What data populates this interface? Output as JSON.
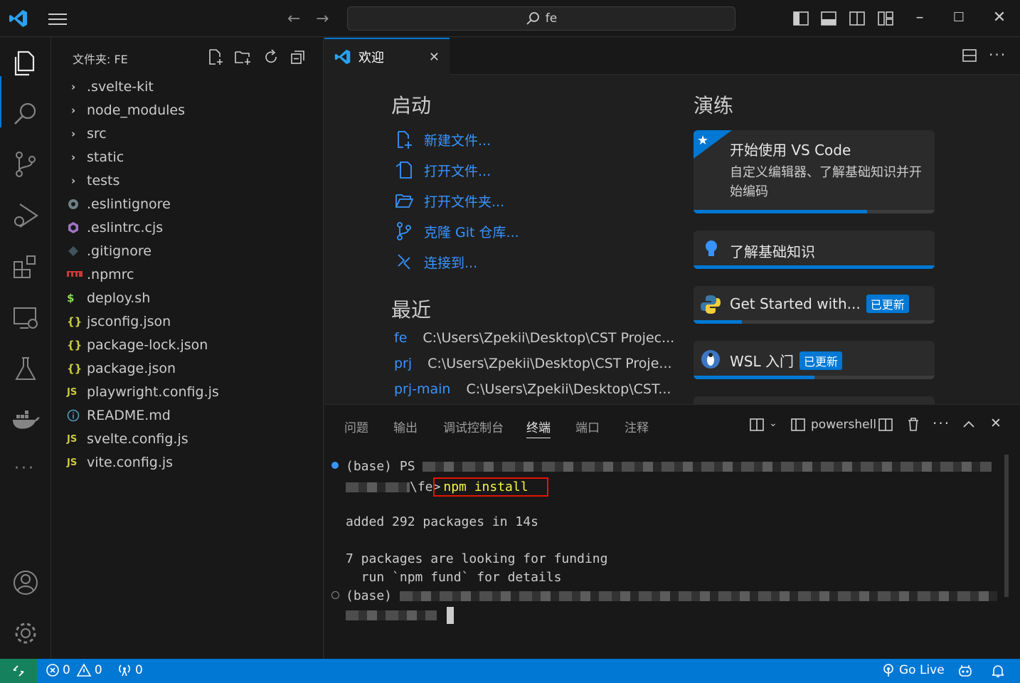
{
  "titlebar": {
    "search_text": "fe"
  },
  "sidebar": {
    "header": "文件夹: FE",
    "items": [
      {
        "label": ".svelte-kit",
        "type": "folder"
      },
      {
        "label": "node_modules",
        "type": "folder"
      },
      {
        "label": "src",
        "type": "folder"
      },
      {
        "label": "static",
        "type": "folder"
      },
      {
        "label": "tests",
        "type": "folder"
      },
      {
        "label": ".eslintignore",
        "icon": "gear-file-icon",
        "color": "#6d8086"
      },
      {
        "label": ".eslintrc.cjs",
        "icon": "eslint-icon",
        "color": "#a074c4"
      },
      {
        "label": ".gitignore",
        "icon": "git-icon",
        "color": "#41535b"
      },
      {
        "label": ".npmrc",
        "icon": "npm-icon",
        "color": "#cb3837"
      },
      {
        "label": "deploy.sh",
        "icon": "dollar-icon",
        "color": "#4d5a5e"
      },
      {
        "label": "jsconfig.json",
        "icon": "braces-icon",
        "color": "#cbcb41"
      },
      {
        "label": "package-lock.json",
        "icon": "braces-icon",
        "color": "#cbcb41"
      },
      {
        "label": "package.json",
        "icon": "braces-icon",
        "color": "#cbcb41"
      },
      {
        "label": "playwright.config.js",
        "icon": "js-icon",
        "color": "#cbcb41"
      },
      {
        "label": "README.md",
        "icon": "info-icon",
        "color": "#519aba"
      },
      {
        "label": "svelte.config.js",
        "icon": "js-icon",
        "color": "#cbcb41"
      },
      {
        "label": "vite.config.js",
        "icon": "js-icon",
        "color": "#cbcb41"
      }
    ]
  },
  "tab": {
    "label": "欢迎"
  },
  "welcome": {
    "start_heading": "启动",
    "start_items": [
      {
        "label": "新建文件..."
      },
      {
        "label": "打开文件..."
      },
      {
        "label": "打开文件夹..."
      },
      {
        "label": "克隆 Git 仓库..."
      },
      {
        "label": "连接到..."
      }
    ],
    "recent_heading": "最近",
    "recent": [
      {
        "name": "fe",
        "path": "C:\\Users\\Zpekii\\Desktop\\CST Projec..."
      },
      {
        "name": "prj",
        "path": "C:\\Users\\Zpekii\\Desktop\\CST Proje..."
      },
      {
        "name": "prj-main",
        "path": "C:\\Users\\Zpekii\\Desktop\\CST..."
      }
    ],
    "walk_heading": "演练",
    "cards": [
      {
        "title": "开始使用 VS Code",
        "desc": "自定义编辑器、了解基础知识并开始编码",
        "progress": 0.72
      },
      {
        "title": "了解基础知识",
        "progress": 1.0
      },
      {
        "title": "Get Started with...",
        "badge": "已更新",
        "progress": 0.2
      },
      {
        "title": "WSL 入门",
        "badge": "已更新",
        "progress": 0.5
      }
    ]
  },
  "panel": {
    "tabs": [
      "问题",
      "输出",
      "调试控制台",
      "终端",
      "端口",
      "注释"
    ],
    "active_tab": "终端",
    "shell": "powershell",
    "lines": {
      "l1": "(base) PS",
      "l2": "\\fe>",
      "cmd": "npm install",
      "l3": "added 292 packages in 14s",
      "l4": "7 packages are looking for funding",
      "l5": "  run `npm fund` for details",
      "l6": "(base)"
    }
  },
  "statusbar": {
    "errors": "0",
    "warnings": "0",
    "ports": "0",
    "golive": "Go Live"
  },
  "colors": {
    "accent": "#0078d4",
    "link": "#3794ff",
    "remote": "#16825d"
  }
}
